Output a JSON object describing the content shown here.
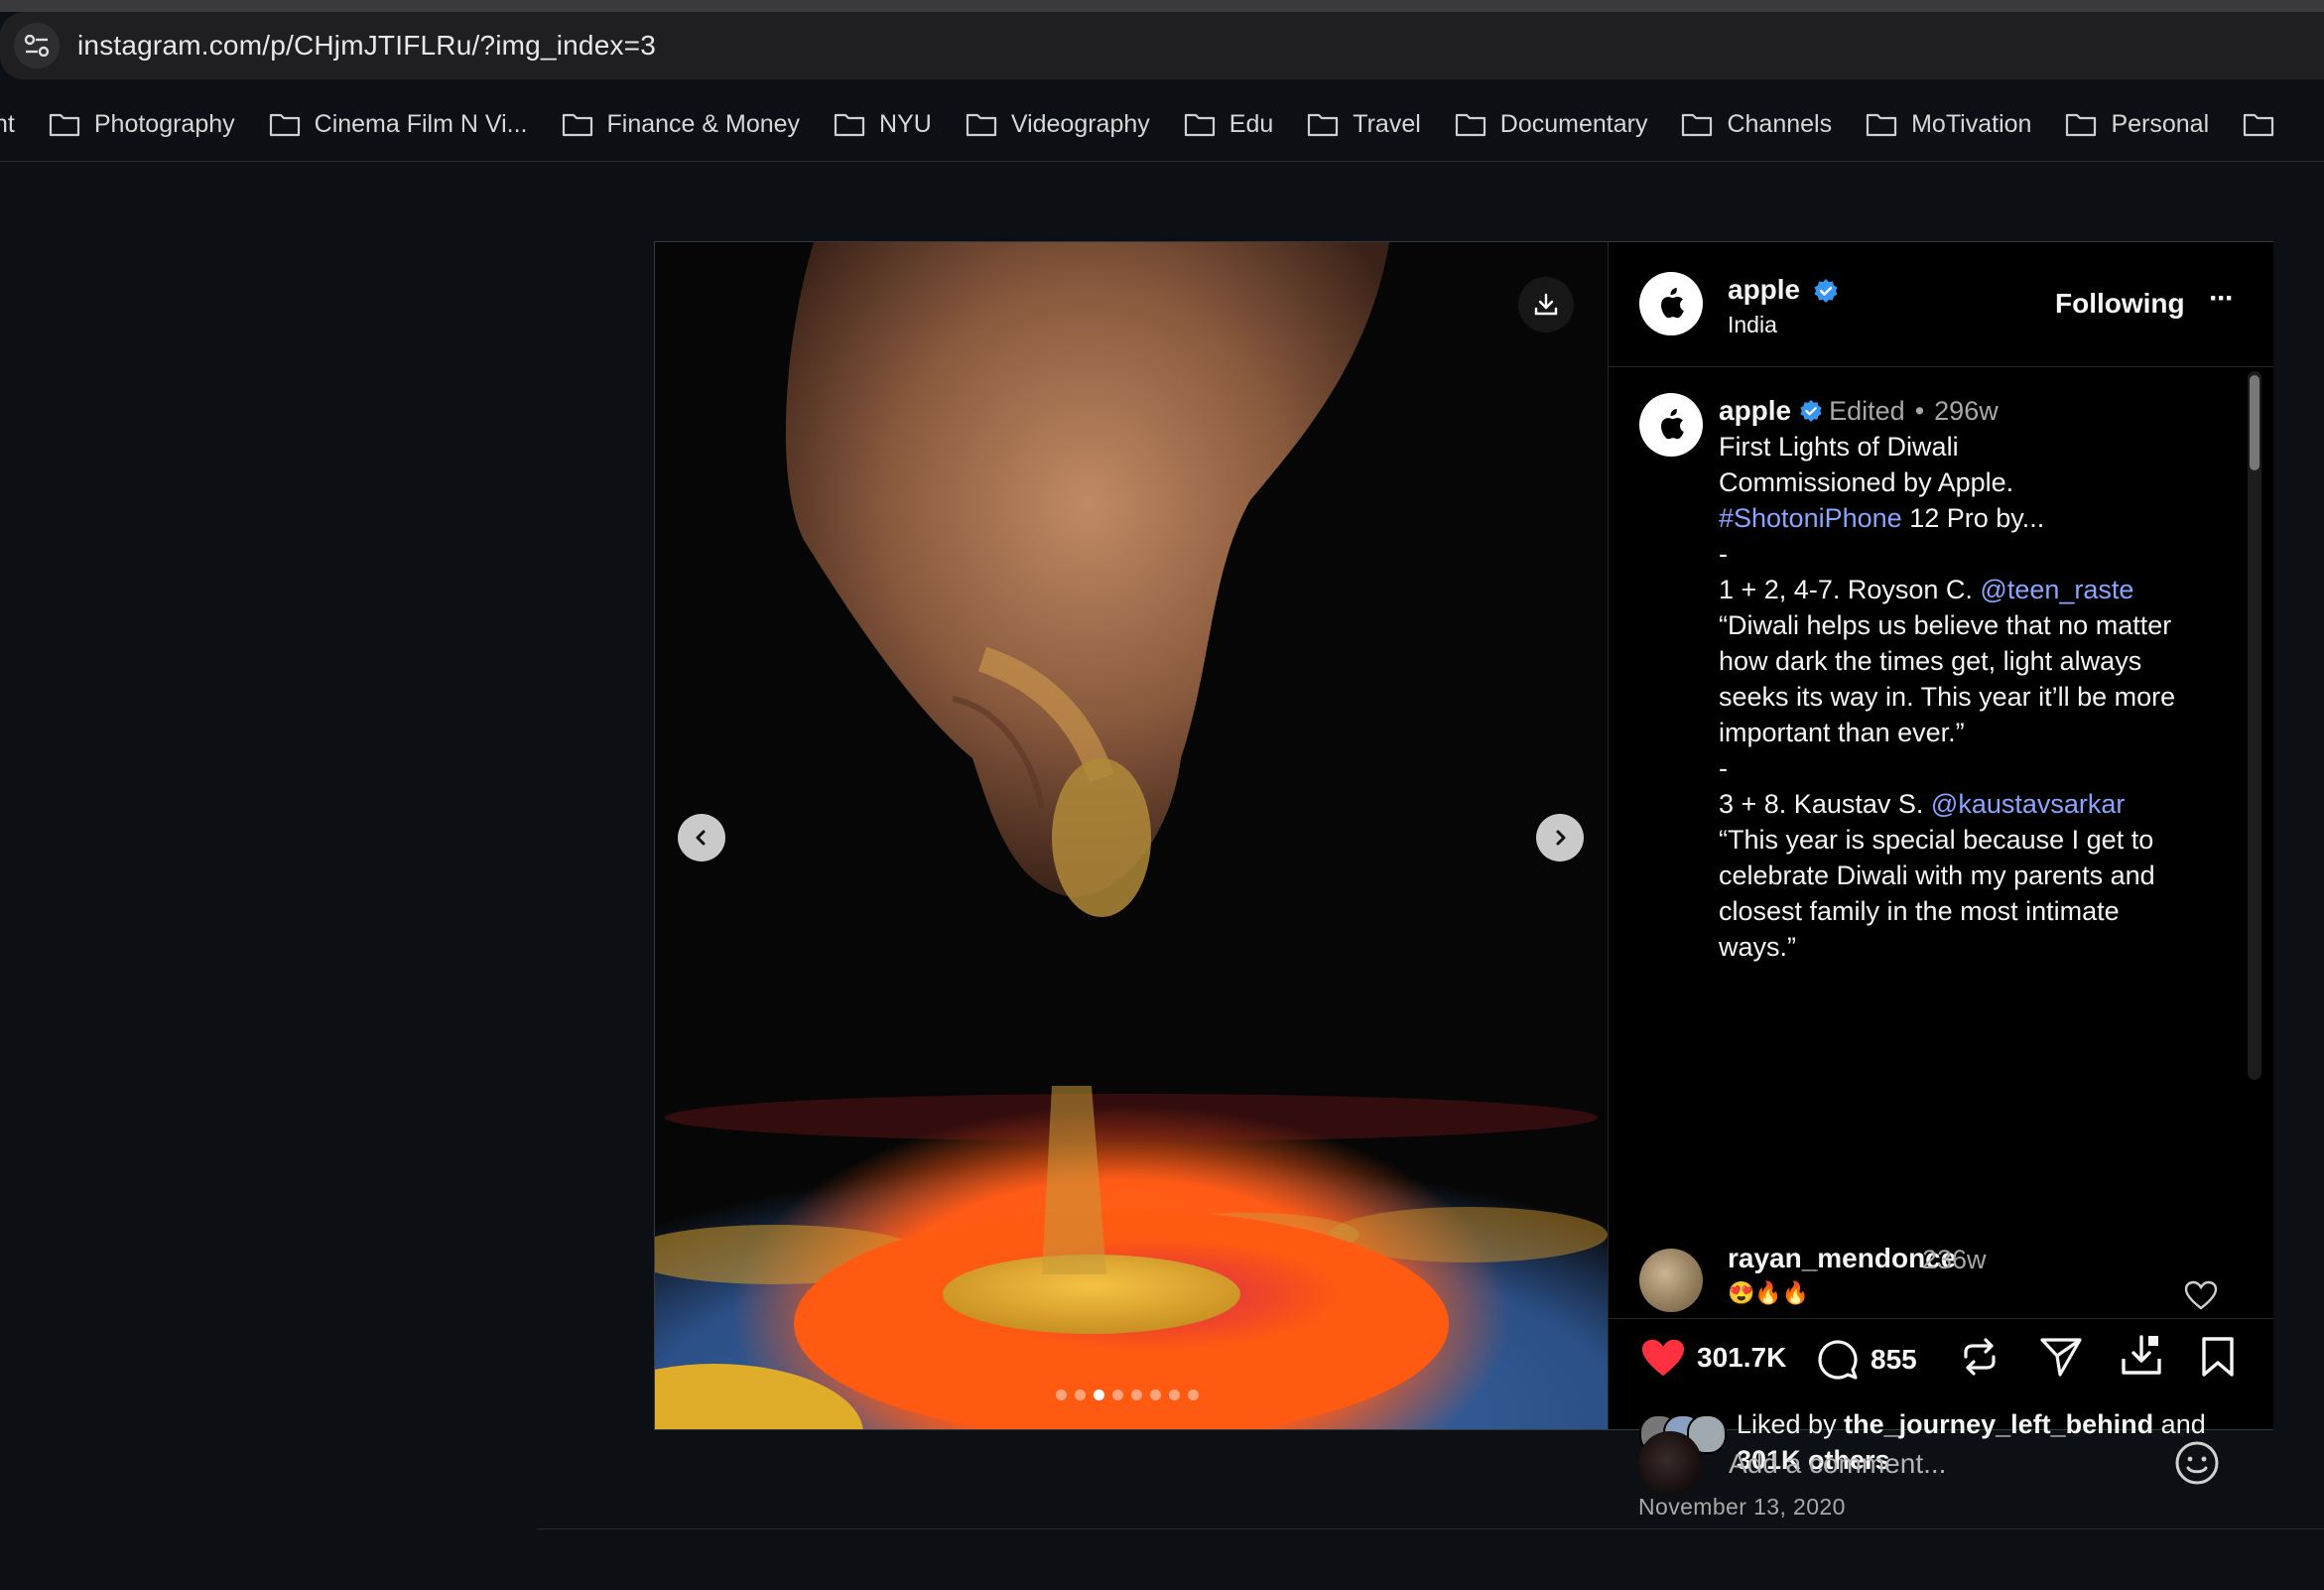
{
  "browser": {
    "url": "instagram.com/p/CHjmJTIFLRu/?img_index=3",
    "bookmarks": [
      "nt",
      "Photography",
      "Cinema Film N Vi...",
      "Finance & Money",
      "NYU",
      "Videography",
      "Edu",
      "Travel",
      "Documentary",
      "Channels",
      "MoTivation",
      "Personal"
    ]
  },
  "post": {
    "carousel": {
      "total": 8,
      "active_index": 3
    },
    "header": {
      "username": "apple",
      "location": "India",
      "follow_label": "Following",
      "more_label": "···"
    },
    "caption": {
      "username": "apple",
      "edited": "Edited",
      "separator": "•",
      "time": "296w",
      "lines": [
        "First Lights of Diwali",
        "Commissioned by Apple.",
        "12 Pro by...",
        "-",
        "1 + 2, 4-7. Royson C.",
        "“Diwali helps us believe that no matter",
        "how dark the times get, light always",
        "seeks its way in. This year it’ll be more",
        "important than ever.”",
        "-",
        "3 + 8. Kaustav S.",
        "“This year is special because I get to",
        "celebrate Diwali with my parents and",
        "closest family in the most intimate",
        "ways.”"
      ],
      "hashtag": "#ShotoniPhone",
      "mention_1": "@teen_raste",
      "mention_2": "@kaustavsarkar"
    },
    "top_comment": {
      "username": "rayan_mendonce",
      "time": "236w",
      "text": "😍🔥🔥"
    },
    "actions": {
      "likes": "301.7K",
      "comments": "855"
    },
    "liked_by": {
      "prefix": "Liked by",
      "user": "the_journey_left_behind",
      "and": "and",
      "others": "301K others"
    },
    "date": "November 13, 2020",
    "comment_placeholder": "Add a comment..."
  },
  "colors": {
    "accent_link": "#8aa4ff",
    "like_red": "#ff3040",
    "verified_blue": "#3797f0"
  }
}
